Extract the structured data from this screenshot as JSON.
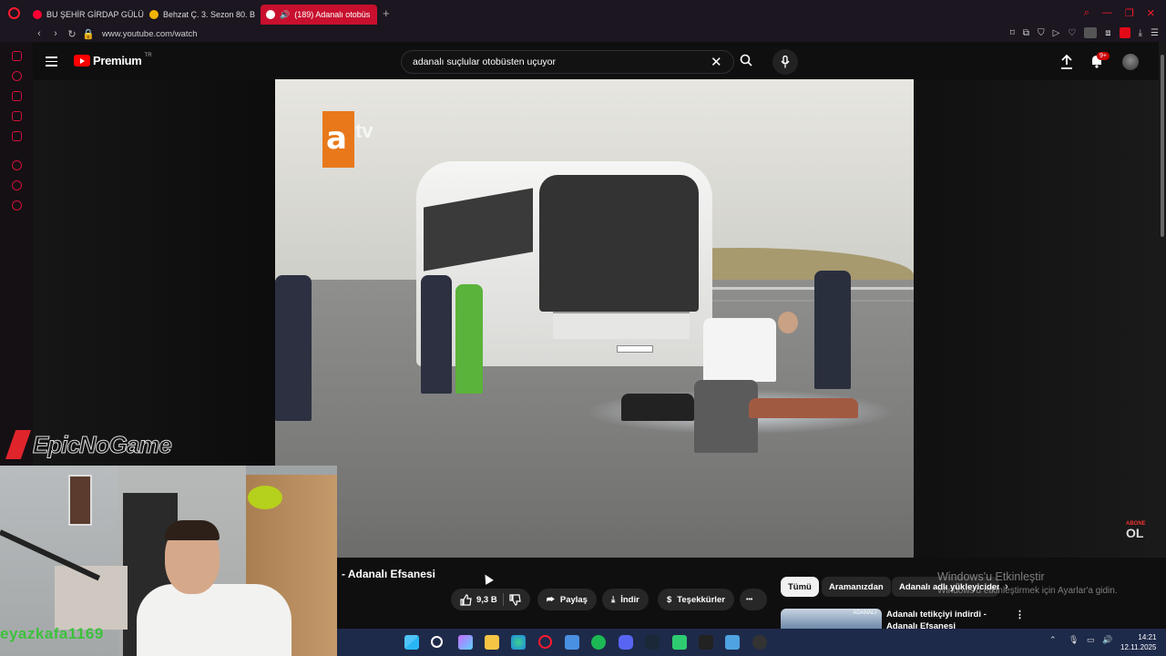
{
  "browser": {
    "tabs": [
      {
        "label": "BU ŞEHİR GİRDAP GÜLÜ",
        "favicon_color": "#ff0033"
      },
      {
        "label": "Behzat Ç. 3. Sezon 80. B",
        "favicon_color": "#f0b400"
      },
      {
        "label": "(189) Adanalı otobüs",
        "favicon_color": "#ff0033",
        "active": true,
        "audio": true
      }
    ],
    "url": "www.youtube.com/watch",
    "new_tab": "+"
  },
  "youtube": {
    "logo_text": "Premium",
    "region": "TR",
    "search_value": "adanalı suçlular otobüsten uçuyor",
    "notifications_badge": "9+"
  },
  "video": {
    "channel_logo": "a",
    "channel_logo_suffix": "tv",
    "overlay_line1": "ABONE",
    "overlay_line2": "OL",
    "title": "- Adanalı Efsanesi"
  },
  "actions": {
    "like_count": "9,3 B",
    "share": "Paylaş",
    "download": "İndir",
    "thanks": "Teşekkürler",
    "more": "•••"
  },
  "chips": [
    "Tümü",
    "Aramanızdan",
    "Adanalı adlı yükleyiciden"
  ],
  "recommendation": {
    "title": "Adanalı tetikçiyi indirdi - Adanalı Efsanesi",
    "thumb_label": "ADANALI"
  },
  "windows": {
    "activation_title": "Windows'u Etkinleştir",
    "activation_sub": "Windows'u etkinleştirmek için Ayarlar'a gidin.",
    "time": "14:21",
    "date": "12.11.2025"
  },
  "stream": {
    "brand": "EpicNoGame",
    "username": "eyazkafa1169"
  },
  "colors": {
    "accent": "#c8102e",
    "yt_red": "#ff0000",
    "taskbar": "#1e2a4a"
  }
}
